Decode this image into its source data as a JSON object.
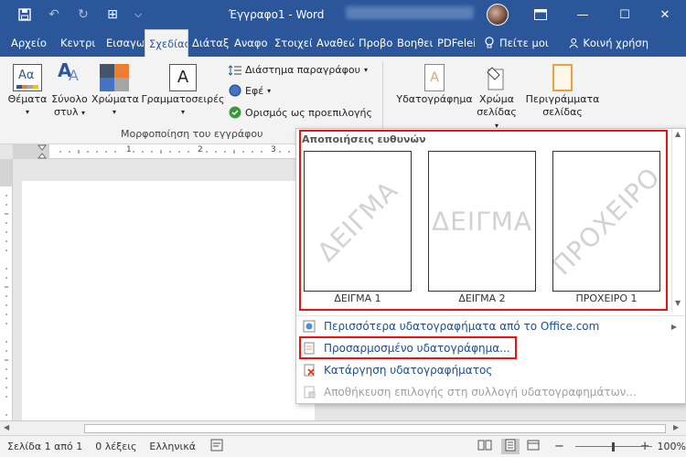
{
  "titlebar": {
    "title": "Έγγραφο1 - Word",
    "qat_save": "💾",
    "qat_undo": "↶",
    "qat_redo": "↻",
    "qat_touch": "⊞",
    "qat_more": "⌵",
    "ribbon_opts": "▭",
    "minimize": "—",
    "maximize": "☐",
    "close": "✕"
  },
  "tabs": [
    {
      "label": "Αρχείο"
    },
    {
      "label": "Κεντρι"
    },
    {
      "label": "Εισαγω"
    },
    {
      "label": "Σχεδίασ"
    },
    {
      "label": "Διάταξ"
    },
    {
      "label": "Αναφο"
    },
    {
      "label": "Στοιχεί"
    },
    {
      "label": "Αναθεώ"
    },
    {
      "label": "Προβο"
    },
    {
      "label": "Βοηθει"
    },
    {
      "label": "PDFelei"
    }
  ],
  "tell_me": "Πείτε μοι",
  "share": "Κοινή χρήση",
  "ribbon": {
    "themes": "Θέματα",
    "style_set_1": "Σύνολο",
    "style_set_2": "στυλ",
    "colors": "Χρώματα",
    "fonts": "Γραμματοσειρές",
    "paragraph_spacing": "Διάστημα παραγράφου",
    "effects": "Εφέ",
    "set_default": "Ορισμός ως προεπιλογής",
    "group_label": "Μορφοποίηση του εγγράφου",
    "watermark": "Υδατογράφημα",
    "page_color_1": "Χρώμα",
    "page_color_2": "σελίδας",
    "page_borders_1": "Περιγράμματα",
    "page_borders_2": "σελίδας",
    "aa": "Aα",
    "a": "A"
  },
  "ruler": {
    "mark1": "1",
    "mark2": "2",
    "mark3": "3"
  },
  "dropdown": {
    "header": "Αποποιήσεις ευθυνών",
    "items": [
      {
        "text": "ΔΕΙΓΜΑ",
        "label": "ΔΕΙΓΜΑ 1"
      },
      {
        "text": "ΔΕΙΓΜΑ",
        "label": "ΔΕΙΓΜΑ 2"
      },
      {
        "text": "ΠΡΟΧΕΙΡΟ",
        "label": "ΠΡΟΧΕΙΡΟ 1"
      }
    ],
    "more": "Περισσότερα υδατογραφήματα από το Office.com",
    "custom": "Προσαρμοσμένο υδατογράφημα...",
    "remove": "Κατάργηση υδατογραφήματος",
    "save": "Αποθήκευση επιλογής στη συλλογή υδατογραφημάτων..."
  },
  "status": {
    "page": "Σελίδα 1 από 1",
    "words": "0 λέξεις",
    "lang": "Ελληνικά",
    "zoom": "100%",
    "minus": "−",
    "plus": "+"
  },
  "colors": {
    "word_blue": "#2b579a",
    "highlight": "#e11111"
  }
}
